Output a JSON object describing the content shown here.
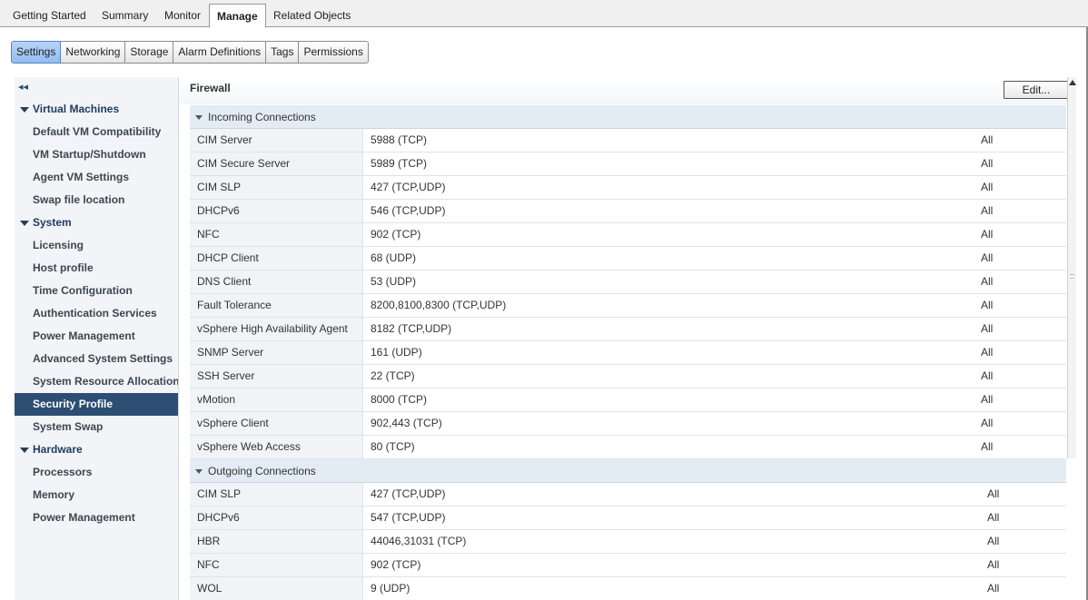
{
  "top_tabs": [
    "Getting Started",
    "Summary",
    "Monitor",
    "Manage",
    "Related Objects"
  ],
  "sub_tabs": [
    "Settings",
    "Networking",
    "Storage",
    "Alarm Definitions",
    "Tags",
    "Permissions"
  ],
  "sidebar": {
    "collapse_glyph": "◂◂",
    "items": [
      {
        "label": "Virtual Machines",
        "type": "group"
      },
      {
        "label": "Default VM Compatibility",
        "type": "child"
      },
      {
        "label": "VM Startup/Shutdown",
        "type": "child"
      },
      {
        "label": "Agent VM Settings",
        "type": "child"
      },
      {
        "label": "Swap file location",
        "type": "child"
      },
      {
        "label": "System",
        "type": "group"
      },
      {
        "label": "Licensing",
        "type": "child"
      },
      {
        "label": "Host profile",
        "type": "child"
      },
      {
        "label": "Time Configuration",
        "type": "child"
      },
      {
        "label": "Authentication Services",
        "type": "child"
      },
      {
        "label": "Power Management",
        "type": "child"
      },
      {
        "label": "Advanced System Settings",
        "type": "child"
      },
      {
        "label": "System Resource Allocation",
        "type": "child"
      },
      {
        "label": "Security Profile",
        "type": "child",
        "selected": true
      },
      {
        "label": "System Swap",
        "type": "child"
      },
      {
        "label": "Hardware",
        "type": "group"
      },
      {
        "label": "Processors",
        "type": "child"
      },
      {
        "label": "Memory",
        "type": "child"
      },
      {
        "label": "Power Management",
        "type": "child"
      }
    ]
  },
  "panel": {
    "title": "Firewall",
    "edit_label": "Edit...",
    "scroll_grip": "::"
  },
  "incoming": {
    "label": "Incoming Connections",
    "rows": [
      {
        "service": "CIM Server",
        "ports": "5988 (TCP)",
        "allowed": "All"
      },
      {
        "service": "CIM Secure Server",
        "ports": "5989 (TCP)",
        "allowed": "All"
      },
      {
        "service": "CIM SLP",
        "ports": "427 (TCP,UDP)",
        "allowed": "All"
      },
      {
        "service": "DHCPv6",
        "ports": "546 (TCP,UDP)",
        "allowed": "All"
      },
      {
        "service": "NFC",
        "ports": "902 (TCP)",
        "allowed": "All"
      },
      {
        "service": "DHCP Client",
        "ports": "68 (UDP)",
        "allowed": "All"
      },
      {
        "service": "DNS Client",
        "ports": "53 (UDP)",
        "allowed": "All"
      },
      {
        "service": "Fault Tolerance",
        "ports": "8200,8100,8300 (TCP,UDP)",
        "allowed": "All"
      },
      {
        "service": "vSphere High Availability Agent",
        "ports": "8182 (TCP,UDP)",
        "allowed": "All"
      },
      {
        "service": "SNMP Server",
        "ports": "161 (UDP)",
        "allowed": "All"
      },
      {
        "service": "SSH Server",
        "ports": "22 (TCP)",
        "allowed": "All"
      },
      {
        "service": "vMotion",
        "ports": "8000 (TCP)",
        "allowed": "All"
      },
      {
        "service": "vSphere Client",
        "ports": "902,443 (TCP)",
        "allowed": "All"
      },
      {
        "service": "vSphere Web Access",
        "ports": "80 (TCP)",
        "allowed": "All"
      }
    ]
  },
  "outgoing": {
    "label": "Outgoing Connections",
    "rows": [
      {
        "service": "CIM SLP",
        "ports": "427 (TCP,UDP)",
        "allowed": "All"
      },
      {
        "service": "DHCPv6",
        "ports": "547 (TCP,UDP)",
        "allowed": "All"
      },
      {
        "service": "HBR",
        "ports": "44046,31031 (TCP)",
        "allowed": "All"
      },
      {
        "service": "NFC",
        "ports": "902 (TCP)",
        "allowed": "All"
      },
      {
        "service": "WOL",
        "ports": "9 (UDP)",
        "allowed": "All"
      }
    ]
  }
}
